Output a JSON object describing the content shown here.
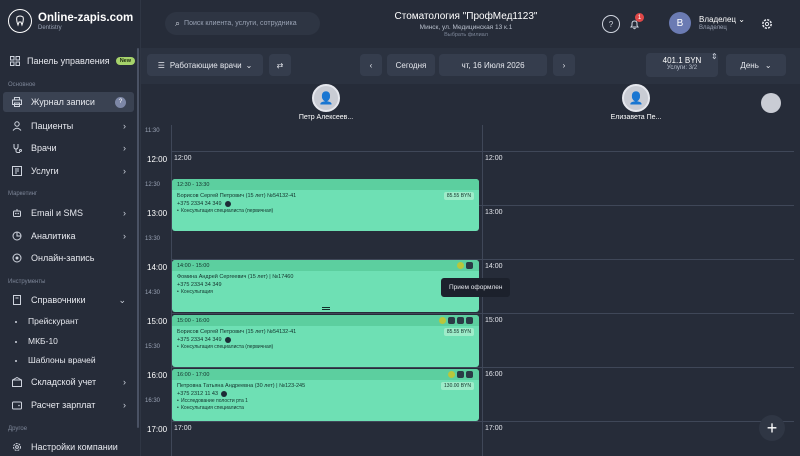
{
  "brand": {
    "name": "Online-zapis.com",
    "sub": "Dentistry"
  },
  "sidebar": {
    "dashboard": {
      "label": "Панель управления",
      "badge": "New"
    },
    "section1": "Основное",
    "journal": {
      "label": "Журнал записи",
      "badge": "?"
    },
    "patients": "Пациенты",
    "doctors": "Врачи",
    "services": "Услуги",
    "section2": "Маркетинг",
    "sms": "Email и SMS",
    "analytics": "Аналитика",
    "online": "Онлайн-запись",
    "section3": "Инструменты",
    "refs": "Справочники",
    "sub1": "Прейскурант",
    "sub2": "МКБ-10",
    "sub3": "Шаблоны врачей",
    "stock": "Складской учет",
    "salary": "Расчет зарплат",
    "section4": "Другое",
    "settings": "Настройки компании"
  },
  "top": {
    "search_placeholder": "Поиск клиента, услуги, сотрудника",
    "clinic_title": "Стоматология \"ПрофМед1123\"",
    "clinic_address": "Минск, ул. Медицинская 13 к.1",
    "clinic_change": "Выбрать филиал",
    "notif_count": "1",
    "user_name": "Владелец",
    "user_role": "Владелец",
    "avatar_letter": "В"
  },
  "toolbar": {
    "working_doctors": "Работающие врачи",
    "today": "Сегодня",
    "date": "чт, 16 Июля 2026",
    "total_value": "401.1 BYN",
    "total_sub": "Услуги: 3/2",
    "view": "День"
  },
  "doctors": [
    {
      "name": "Петр Алексеев..."
    },
    {
      "name": "Елизавета Пе..."
    }
  ],
  "times": {
    "t1130": "11:30",
    "t12": "12:00",
    "t1230": "12:30",
    "t13": "13:00",
    "t1330": "13:30",
    "t14": "14:00",
    "t1430": "14:30",
    "t15": "15:00",
    "t1530": "15:30",
    "t16": "16:00",
    "t1630": "16:30",
    "t17": "17:00"
  },
  "appointments": [
    {
      "time": "12:30 - 13:30",
      "patient": "Борисов Сергей Петрович (15 лет) №54132-41",
      "price": "85.55 BYN",
      "phone": "+375 2334 34 349",
      "note": "Консультация специалиста (первичная)"
    },
    {
      "time": "14:00 - 15:00",
      "patient": "Фомина Андрей Сергеевич (15 лет) | №17460",
      "price": "",
      "phone": "+375 2334 34 349",
      "note": "Консультация"
    },
    {
      "time": "15:00 - 16:00",
      "patient": "Борисов Сергей Петрович (15 лет) №54132-41",
      "price": "85.55 BYN",
      "phone": "+375 2334 34 349",
      "note": "Консультация специалиста (первичная)"
    },
    {
      "time": "16:00 - 17:00",
      "patient": "Петровна Татьяна Андреевна (30 лет) | №123-245",
      "price": "130.00 BYN",
      "phone": "+375 2312 11 43",
      "note": "Исследование полости рта 1",
      "note2": "Консультация специалиста"
    }
  ],
  "tooltip": "Прием оформлен"
}
